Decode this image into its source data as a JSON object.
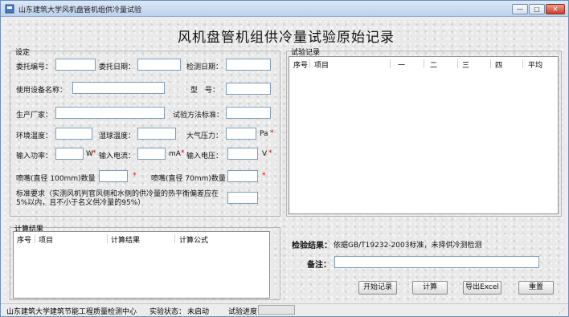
{
  "window": {
    "title": "山东建筑大学风机盘管机组供冷量试验",
    "minimize": "—",
    "maximize": "□",
    "close": "✕"
  },
  "main_title": "风机盘管机组供冷量试验原始记录",
  "settings": {
    "group_label": "设定",
    "commission_no": "委托编号：",
    "commission_date": "委托日期：",
    "test_date": "检测日期：",
    "device_name": "使用设备名称：",
    "model": "型　号：",
    "manufacturer": "生产厂家：",
    "test_standard": "试验方法标准：",
    "ambient_temp": "环境温度：",
    "wet_bulb_temp": "湿球温度：",
    "air_pressure": "大气压力：",
    "air_pressure_unit": "Pa",
    "input_power": "输入功率：",
    "input_power_unit": "W",
    "input_current": "输入电流：",
    "input_current_unit": "mA",
    "input_voltage": "输入电压：",
    "input_voltage_unit": "V",
    "nozzle_100": "喷嘴(直径 100mm)数量",
    "nozzle_70": "喷嘴(直径 70mm)数量",
    "standard_req": "标准要求（实测风机判官风侧和水侧的供冷量的热平衡偏差应在5%以内，且不小于名义供冷量的95%）",
    "required_mark": "*"
  },
  "test_record": {
    "group_label": "试验记录",
    "columns": [
      "序号",
      "项目",
      "一",
      "二",
      "三",
      "四",
      "平均"
    ]
  },
  "calc_result": {
    "group_label": "计算结果",
    "columns": [
      "序号",
      "项目",
      "计算结果",
      "计算公式"
    ]
  },
  "inspection": {
    "label": "检验结果：",
    "text": "依据GB/T19232-2003标准，未择供冷测检测"
  },
  "remark": {
    "label": "备注："
  },
  "buttons": {
    "start": "开始记录",
    "calc": "计算",
    "export": "导出Excel",
    "reset": "重置"
  },
  "status": {
    "org": "山东建筑大学建筑节能工程质量检测中心",
    "state_label": "实验状态：",
    "state_value": "未启动",
    "progress_label": "试验进度"
  }
}
